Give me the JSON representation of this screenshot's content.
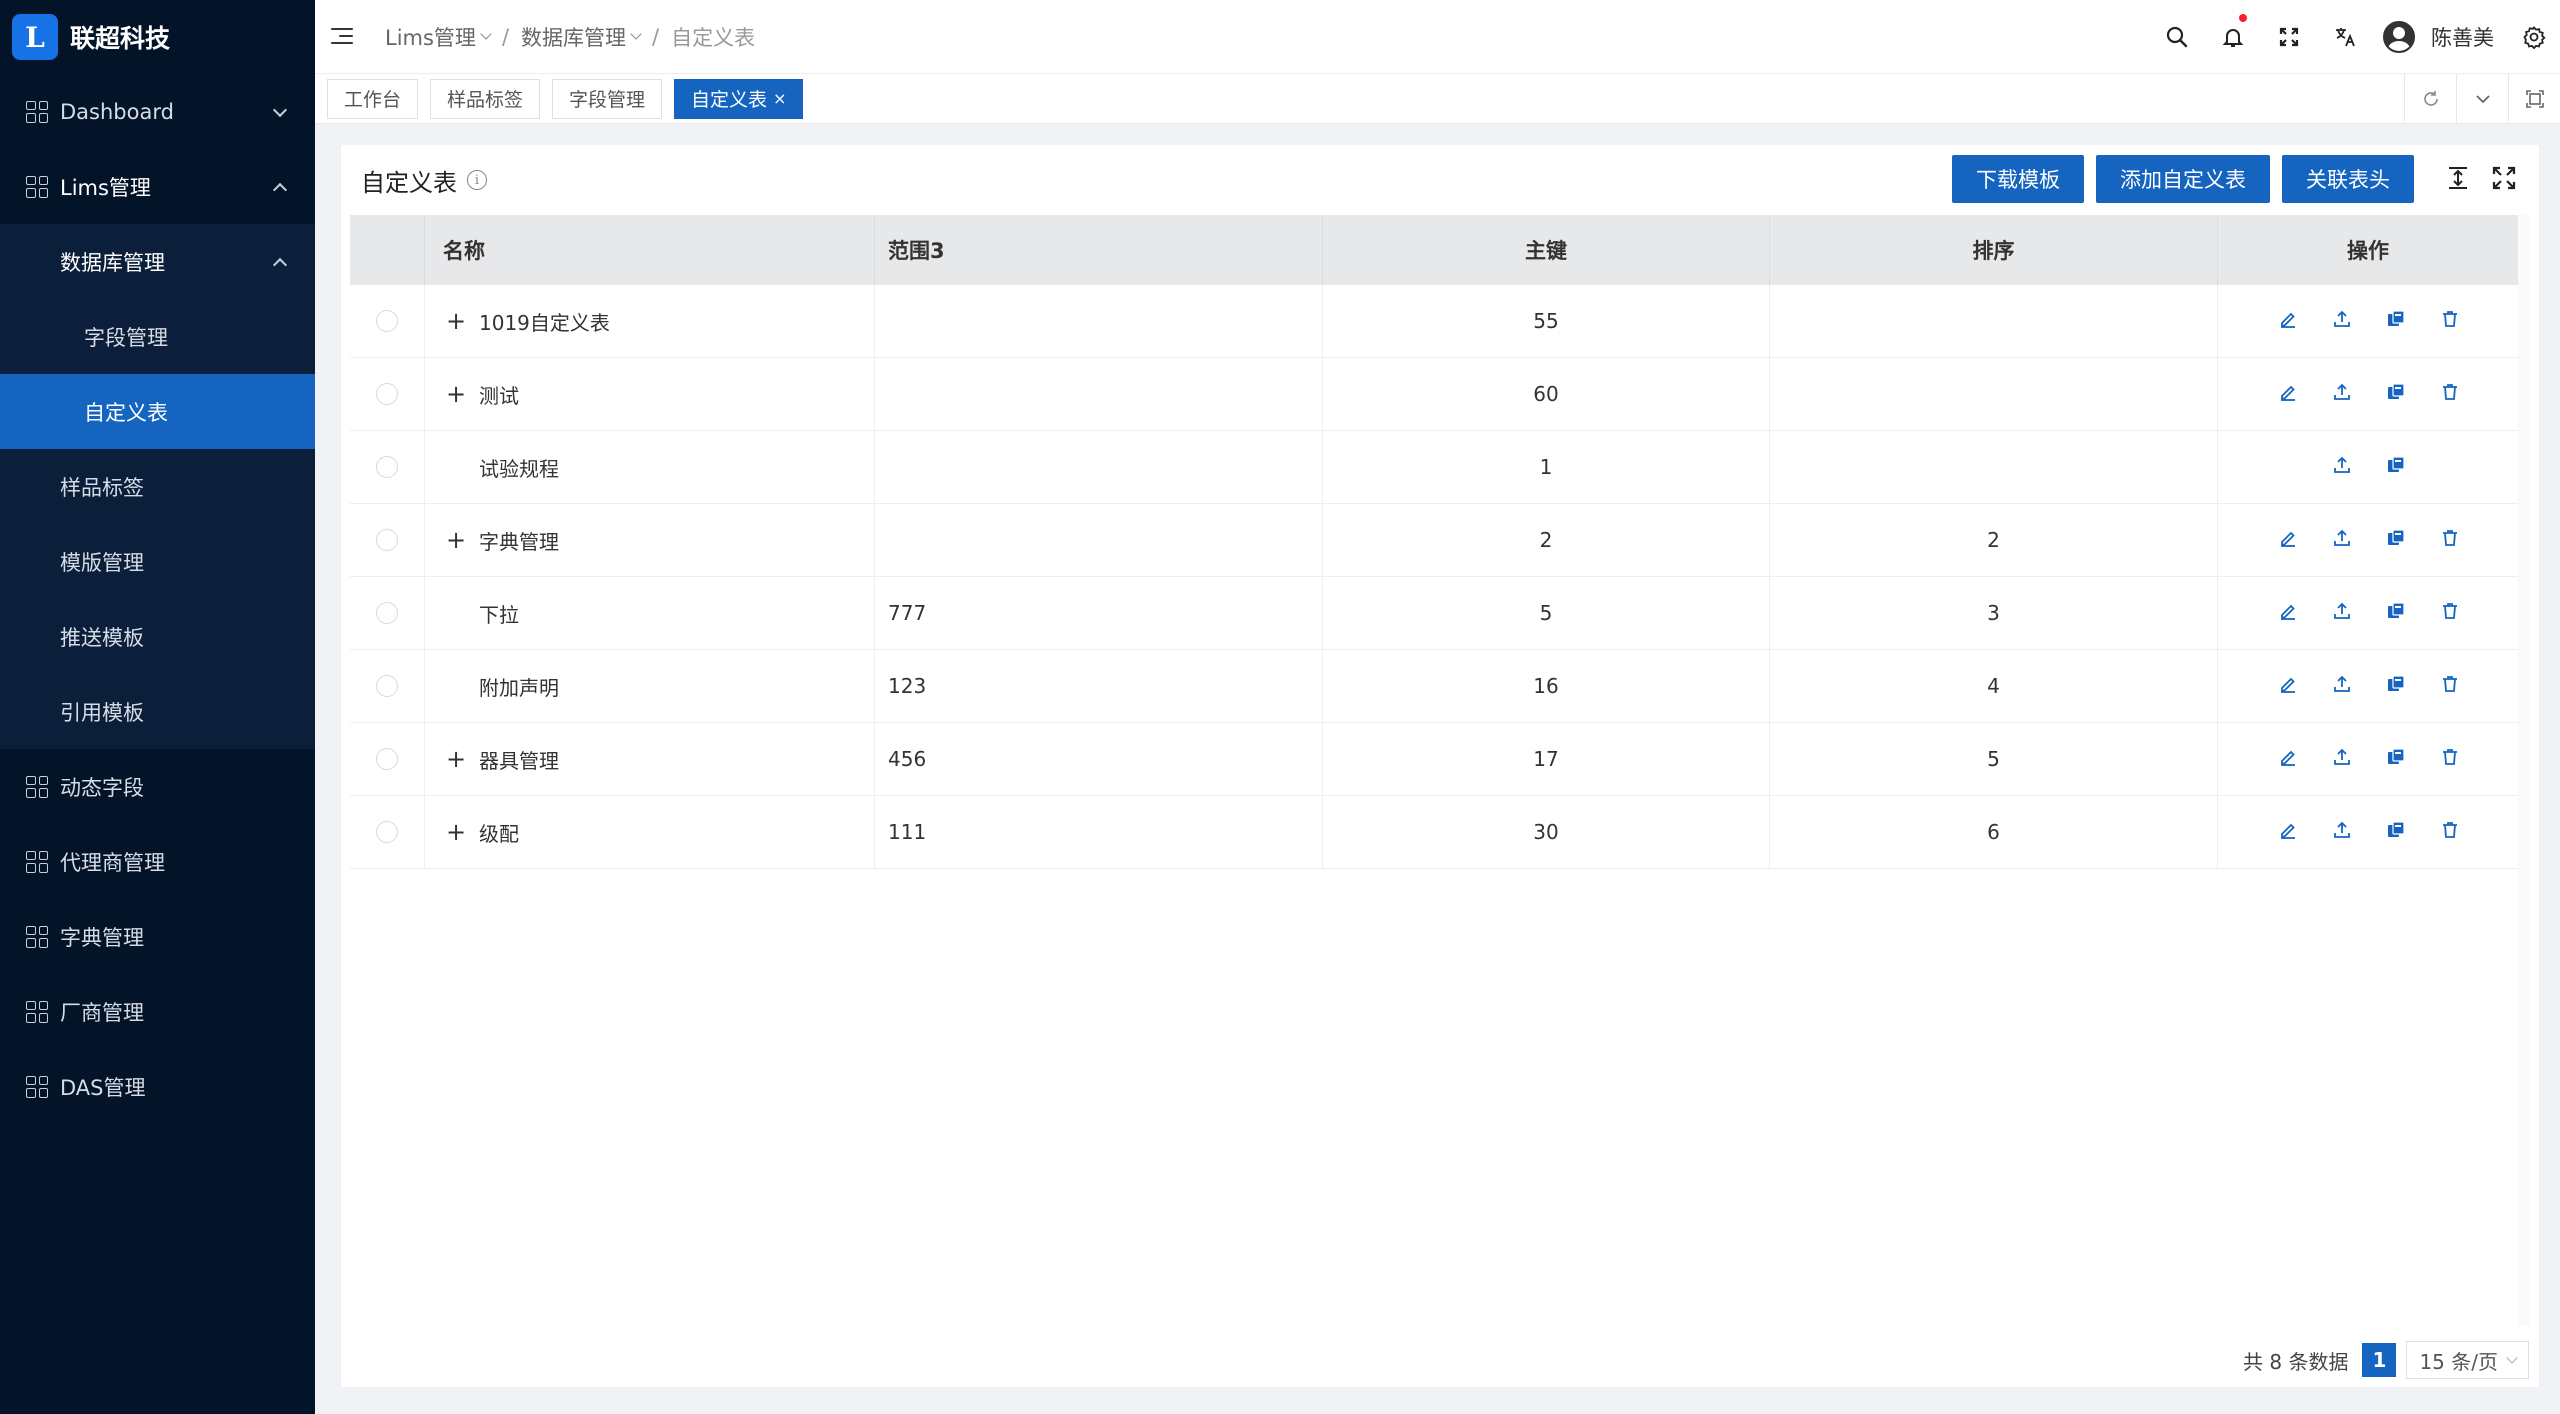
{
  "app": {
    "name": "联超科技",
    "logo_letter": "L"
  },
  "sidebar": {
    "items": [
      {
        "label": "Dashboard",
        "state": "collapsed"
      },
      {
        "label": "Lims管理",
        "state": "expanded"
      },
      {
        "label": "动态字段"
      },
      {
        "label": "代理商管理"
      },
      {
        "label": "字典管理"
      },
      {
        "label": "厂商管理"
      },
      {
        "label": "DAS管理"
      }
    ],
    "lims_children": [
      {
        "label": "数据库管理"
      },
      {
        "label": "字段管理"
      },
      {
        "label": "自定义表",
        "selected": true
      },
      {
        "label": "样品标签"
      },
      {
        "label": "模版管理"
      },
      {
        "label": "推送模板"
      },
      {
        "label": "引用模板"
      }
    ]
  },
  "header": {
    "breadcrumb": [
      "Lims管理",
      "数据库管理",
      "自定义表"
    ],
    "user_name": "陈善美",
    "icons": [
      "search-icon",
      "bell-icon",
      "fullscreen-icon",
      "translate-icon",
      "avatar",
      "gear-icon"
    ]
  },
  "tabs": [
    {
      "label": "工作台"
    },
    {
      "label": "样品标签"
    },
    {
      "label": "字段管理"
    },
    {
      "label": "自定义表",
      "active": true,
      "close": "×"
    }
  ],
  "card": {
    "title": "自定义表",
    "buttons": {
      "download": "下载模板",
      "add": "添加自定义表",
      "link": "关联表头"
    }
  },
  "table": {
    "columns": [
      "名称",
      "范围3",
      "主键",
      "排序",
      "操作"
    ],
    "rows": [
      {
        "name": "1019自定义表",
        "expandable": true,
        "range": "",
        "key": "55",
        "sort": "",
        "ops": [
          "edit",
          "upload",
          "copy",
          "delete"
        ]
      },
      {
        "name": "测试",
        "expandable": true,
        "range": "",
        "key": "60",
        "sort": "",
        "ops": [
          "edit",
          "upload",
          "copy",
          "delete"
        ]
      },
      {
        "name": "试验规程",
        "expandable": false,
        "range": "",
        "key": "1",
        "sort": "",
        "ops": [
          "upload",
          "copy"
        ]
      },
      {
        "name": "字典管理",
        "expandable": true,
        "range": "",
        "key": "2",
        "sort": "2",
        "ops": [
          "edit",
          "upload",
          "copy",
          "delete"
        ]
      },
      {
        "name": "下拉",
        "expandable": false,
        "range": "777",
        "key": "5",
        "sort": "3",
        "ops": [
          "edit",
          "upload",
          "copy",
          "delete"
        ]
      },
      {
        "name": "附加声明",
        "expandable": false,
        "range": "123",
        "key": "16",
        "sort": "4",
        "ops": [
          "edit",
          "upload",
          "copy",
          "delete"
        ]
      },
      {
        "name": "器具管理",
        "expandable": true,
        "range": "456",
        "key": "17",
        "sort": "5",
        "ops": [
          "edit",
          "upload",
          "copy",
          "delete"
        ]
      },
      {
        "name": "级配",
        "expandable": true,
        "range": "111",
        "key": "30",
        "sort": "6",
        "ops": [
          "edit",
          "upload",
          "copy",
          "delete"
        ]
      }
    ],
    "expand_symbol": "+"
  },
  "pagination": {
    "total_text": "共 8 条数据",
    "current_page": "1",
    "page_size": "15 条/页"
  },
  "colors": {
    "primary": "#1565c0",
    "sidebar_bg": "#031328",
    "submenu_bg": "#0c1f3a",
    "notification_dot": "#f5222d"
  }
}
